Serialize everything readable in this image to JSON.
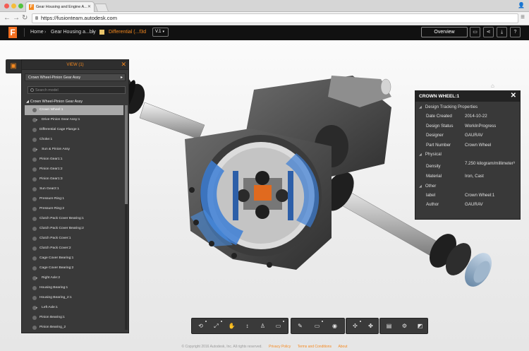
{
  "browser": {
    "tab_title": "Gear Housing and Engine A...",
    "url": "https://fusionteam.autodesk.com"
  },
  "header": {
    "home": "Home",
    "project": "Gear Housing a...bly",
    "document": "Differential (...f3d",
    "version": "V.1",
    "overview": "Overview"
  },
  "tree": {
    "title": "VIEW (1)",
    "dropdown": "Crown Wheel-Pinion Gear Assy",
    "search_placeholder": "Search model",
    "root": "Crown Wheel-Pinion Gear Assy",
    "nodes": [
      {
        "label": "Crown Wheel:1",
        "expandable": false,
        "selected": true
      },
      {
        "label": "Drive Pinion Gear Assy:1",
        "expandable": true
      },
      {
        "label": "Differential Cage Flange:1",
        "expandable": false
      },
      {
        "label": "Choke:1",
        "expandable": false
      },
      {
        "label": "Sun & Pinion Assy",
        "expandable": true
      },
      {
        "label": "Pinion Gear1:1",
        "expandable": false
      },
      {
        "label": "Pinion Gear1:2",
        "expandable": false
      },
      {
        "label": "Pinion Gear1:3",
        "expandable": false
      },
      {
        "label": "Sun Gear2:1",
        "expandable": false
      },
      {
        "label": "Pressure Ring:1",
        "expandable": false
      },
      {
        "label": "Pressure Ring:2",
        "expandable": false
      },
      {
        "label": "Clutch Pack Cover Bearing:1",
        "expandable": false
      },
      {
        "label": "Clutch Pack Cover Bearing:2",
        "expandable": false
      },
      {
        "label": "Clutch Pack Cover:1",
        "expandable": false
      },
      {
        "label": "Clutch Pack Cover:2",
        "expandable": false
      },
      {
        "label": "Cage Cover Bearing:1",
        "expandable": false
      },
      {
        "label": "Cage Cover Bearing:2",
        "expandable": false
      },
      {
        "label": "Right Axle:2",
        "expandable": true
      },
      {
        "label": "Housing Bearing:1",
        "expandable": false
      },
      {
        "label": "Housing Bearing_2:1",
        "expandable": false
      },
      {
        "label": "Left Axle:1",
        "expandable": true
      },
      {
        "label": "Pinion Bearing:1",
        "expandable": false
      },
      {
        "label": "Pinion Bearing_2",
        "expandable": false
      }
    ]
  },
  "properties": {
    "title": "CROWN WHEEL:1",
    "sections": [
      {
        "name": "Design Tracking Properties",
        "rows": [
          {
            "key": "Date Created",
            "value": "2014-10-22"
          },
          {
            "key": "Design Status",
            "value": "WorkInProgress"
          },
          {
            "key": "Designer",
            "value": "GAURAV"
          },
          {
            "key": "Part Number",
            "value": "Crown Wheel"
          }
        ]
      },
      {
        "name": "Physical",
        "rows": [
          {
            "key": "Density",
            "value": "7.250 kilogram/millimeter³"
          },
          {
            "key": "Material",
            "value": "Iron, Cast"
          }
        ]
      },
      {
        "name": "Other",
        "rows": [
          {
            "key": "label",
            "value": "Crown Wheel:1"
          },
          {
            "key": "Author",
            "value": "GAURAV"
          }
        ]
      }
    ]
  },
  "footer": {
    "copyright": "© Copyright 2016 Autodesk, Inc. All rights reserved.",
    "privacy": "Privacy Policy",
    "terms": "Terms and Conditions",
    "about": "About"
  },
  "colors": {
    "accent": "#f5891f",
    "panel": "#393939",
    "header": "#111111"
  }
}
